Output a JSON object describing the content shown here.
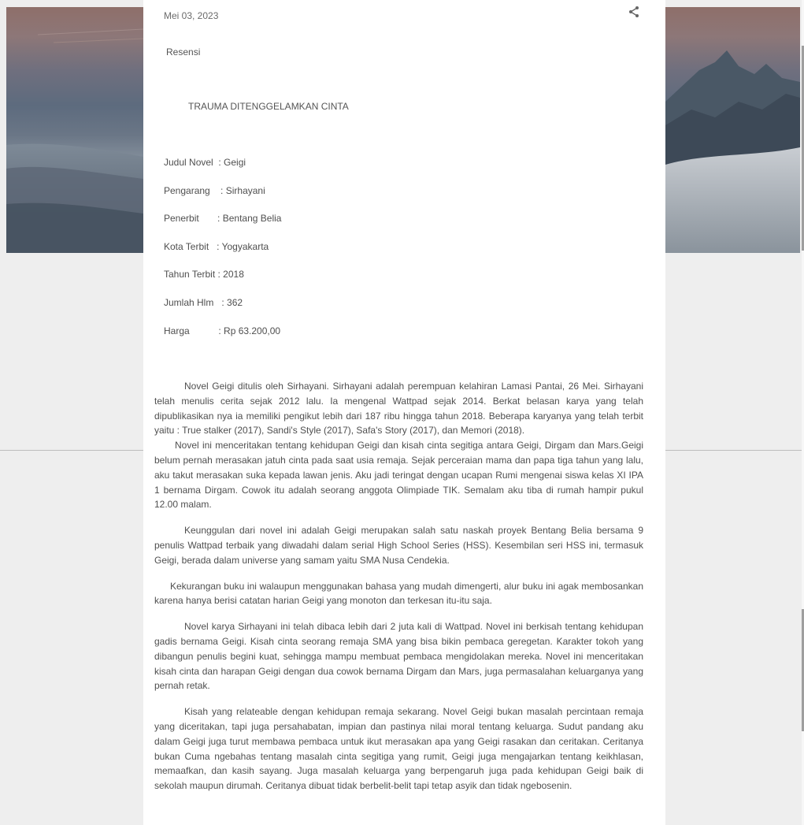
{
  "post": {
    "date": "Mei 03, 2023",
    "label": "Resensi",
    "title": "TRAUMA DITENGGELAMKAN CINTA"
  },
  "book_info": [
    {
      "key": "Judul Novel",
      "sep": "  : ",
      "value": "Geigi"
    },
    {
      "key": "Pengarang",
      "sep": "    : ",
      "value": "Sirhayani"
    },
    {
      "key": "Penerbit",
      "sep": "       : ",
      "value": "Bentang Belia"
    },
    {
      "key": "Kota Terbit",
      "sep": "   : ",
      "value": "Yogyakarta"
    },
    {
      "key": "Tahun Terbit",
      "sep": " : ",
      "value": "2018"
    },
    {
      "key": "Jumlah Hlm",
      "sep": "   : ",
      "value": "362"
    },
    {
      "key": "Harga",
      "sep": "           : ",
      "value": "Rp 63.200,00"
    }
  ],
  "paragraphs": [
    "Novel Geigi ditulis oleh Sirhayani. Sirhayani adalah perempuan kelahiran Lamasi Pantai, 26 Mei. Sirhayani telah menulis cerita sejak 2012 lalu. Ia mengenal Wattpad sejak 2014. Berkat belasan karya yang telah dipublikasikan nya ia memiliki pengikut lebih dari 187 ribu hingga tahun 2018. Beberapa karyanya yang telah terbit yaitu : True stalker (2017), Sandi's Style (2017), Safa's Story (2017), dan Memori (2018).",
    "Novel ini menceritakan tentang kehidupan Geigi dan kisah cinta segitiga antara Geigi, Dirgam dan Mars.Geigi belum pernah merasakan jatuh cinta pada saat usia remaja. Sejak perceraian mama dan papa tiga tahun yang lalu, aku takut merasakan suka kepada lawan jenis. Aku jadi teringat dengan ucapan Rumi mengenai siswa kelas XI IPA 1 bernama Dirgam. Cowok itu adalah seorang anggota Olimpiade TIK. Semalam aku tiba di rumah hampir pukul 12.00 malam.",
    "Keunggulan dari novel ini adalah Geigi merupakan salah satu naskah proyek Bentang Belia bersama 9 penulis Wattpad terbaik yang diwadahi dalam serial High School Series (HSS). Kesembilan seri HSS ini, termasuk Geigi, berada dalam universe yang samam yaitu SMA Nusa Cendekia.",
    "Kekurangan buku ini walaupun menggunakan bahasa yang mudah dimengerti, alur buku ini agak membosankan karena hanya berisi catatan harian Geigi yang monoton dan terkesan itu-itu saja.",
    "Novel karya Sirhayani ini telah dibaca lebih dari 2 juta kali di Wattpad. Novel ini berkisah tentang kehidupan gadis bernama Geigi. Kisah cinta seorang remaja SMA yang bisa bikin pembaca geregetan. Karakter tokoh yang dibangun penulis begini kuat, sehingga mampu membuat pembaca mengidolakan mereka. Novel ini menceritakan kisah cinta dan harapan Geigi dengan dua cowok bernama Dirgam dan Mars, juga permasalahan keluarganya yang pernah retak.",
    "Kisah yang relateable dengan kehidupan remaja sekarang. Novel Geigi bukan masalah percintaan remaja yang diceritakan, tapi juga persahabatan, impian dan pastinya nilai moral tentang keluarga. Sudut pandang aku dalam Geigi juga turut membawa pembaca untuk ikut merasakan apa yang Geigi rasakan dan ceritakan. Ceritanya bukan Cuma ngebahas tentang masalah cinta segitiga yang rumit, Geigi juga mengajarkan tentang keikhlasan, memaafkan, dan kasih sayang. Juga masalah keluarga yang berpengaruh juga pada kehidupan Geigi baik di sekolah maupun dirumah. Ceritanya dibuat tidak berbelit-belit tapi tetap asyik dan tidak ngebosenin."
  ],
  "icons": {
    "share": "share-icon"
  },
  "colors": {
    "card": "#ffffff",
    "page_bg": "#eeeeee",
    "text": "#4f4f4f"
  }
}
